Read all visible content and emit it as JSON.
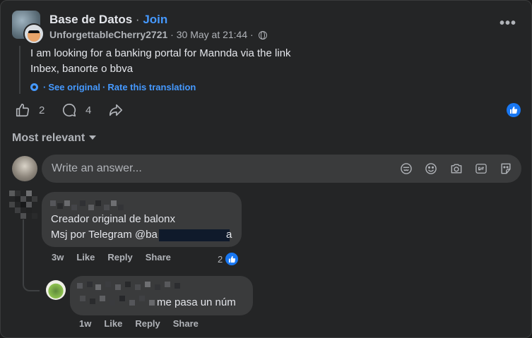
{
  "post": {
    "group_name": "Base de Datos",
    "dot": "·",
    "join_label": "Join",
    "author": "UnforgettableCherry2721",
    "timestamp": "30 May at 21:44",
    "meta_sep": "·",
    "more_label": "•••",
    "lines": [
      "I am looking for a banking portal for Mannda via the link",
      "Inbex, banorte o bbva"
    ],
    "see_original": "See original",
    "rate_translation": "Rate this translation",
    "translate_sep": "·"
  },
  "actions": {
    "like_count": "2",
    "comment_count": "4"
  },
  "sort_label": "Most relevant",
  "composer": {
    "placeholder": "Write an answer..."
  },
  "comments": [
    {
      "lines": [
        "Creador original de balonx",
        "Msj por Telegram @ba",
        "a"
      ],
      "age": "3w",
      "like": "Like",
      "reply": "Reply",
      "share": "Share",
      "reactions": "2"
    },
    {
      "text": "me pasa un núm",
      "age": "1w",
      "like": "Like",
      "reply": "Reply",
      "share": "Share"
    }
  ],
  "colors": {
    "accent": "#4599ff",
    "like_blue": "#1877f2",
    "background": "#242526",
    "bubble": "#3a3b3c"
  },
  "icons": [
    "globe-icon",
    "more-icon",
    "gear-icon",
    "like-icon",
    "comment-icon",
    "share-icon",
    "like-badge-icon",
    "caret-down-icon",
    "avatar-sticker-icon",
    "emoji-icon",
    "camera-icon",
    "gif-icon",
    "sticker-icon"
  ]
}
